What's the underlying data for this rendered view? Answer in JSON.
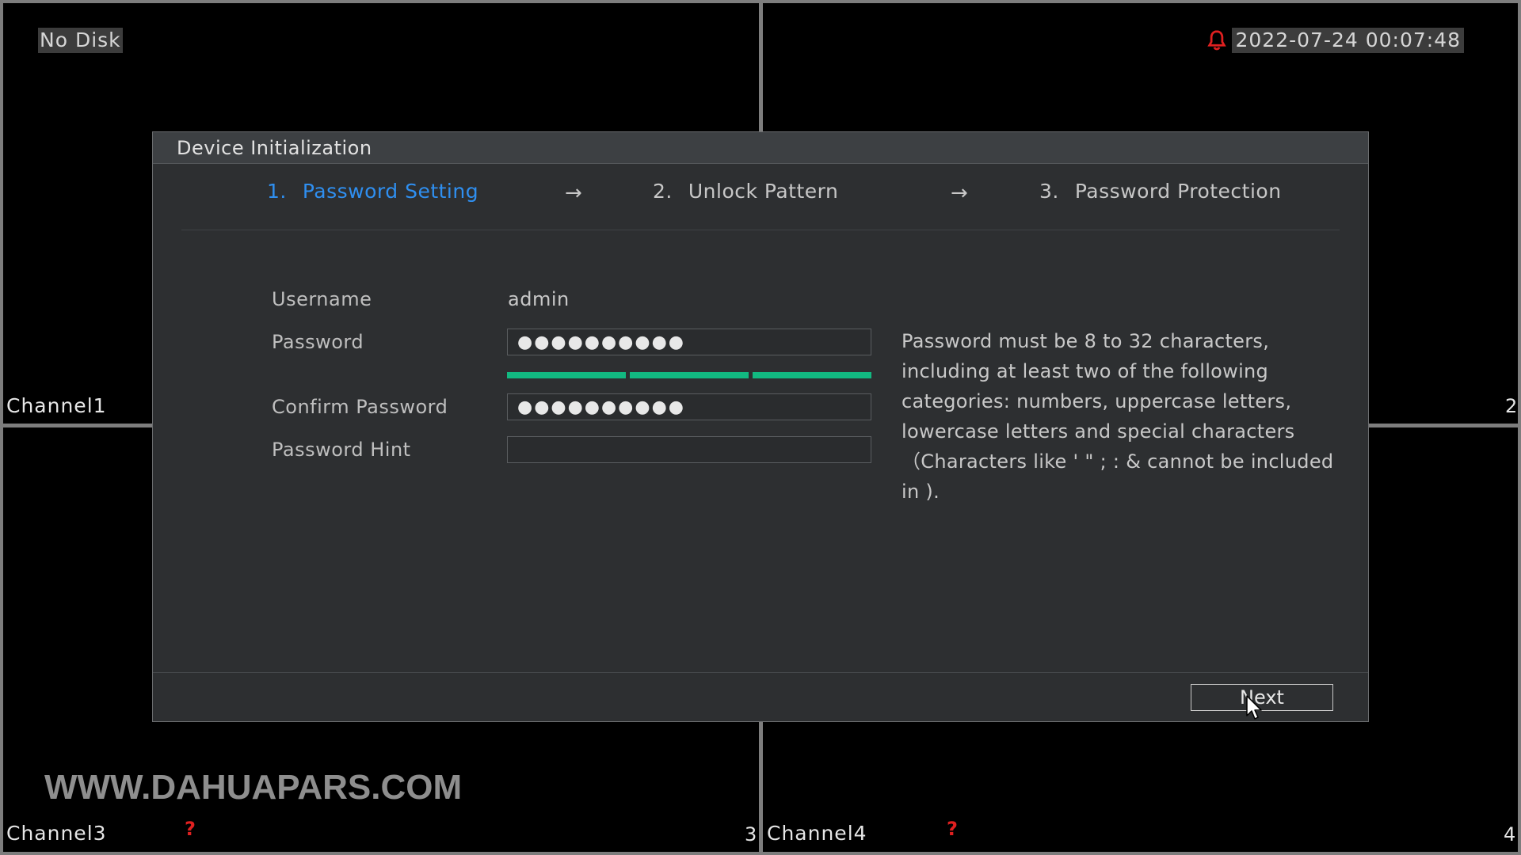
{
  "overlay": {
    "disk_status": "No Disk",
    "datetime": "2022-07-24 00:07:48",
    "watermark": "WWW.DAHUAPARS.COM",
    "channels": [
      {
        "label": "Channel1",
        "num": "1"
      },
      {
        "label": "",
        "num": "2"
      },
      {
        "label": "Channel3",
        "num": "3",
        "status": "?"
      },
      {
        "label": "Channel4",
        "num": "4",
        "status": "?"
      }
    ]
  },
  "dialog": {
    "title": "Device Initialization",
    "steps": [
      {
        "num": "1.",
        "label": "Password Setting",
        "active": true
      },
      {
        "num": "2.",
        "label": "Unlock Pattern",
        "active": false
      },
      {
        "num": "3.",
        "label": "Password Protection",
        "active": false
      }
    ],
    "step_arrow": "→",
    "form": {
      "username_label": "Username",
      "username_value": "admin",
      "password_label": "Password",
      "password_value": "●●●●●●●●●●",
      "confirm_label": "Confirm Password",
      "confirm_value": "●●●●●●●●●●",
      "hint_label": "Password Hint",
      "hint_value": "",
      "strength_segments": 3
    },
    "password_rules": "Password must be 8 to 32 characters, including at least two of the following categories: numbers, uppercase letters, lowercase letters and special characters（Characters like ' \" ; : & cannot be included in ).",
    "next_label": "Next"
  },
  "colors": {
    "active_step": "#2f8ff0",
    "strength_bar": "#12b981",
    "alarm": "#e02020"
  }
}
